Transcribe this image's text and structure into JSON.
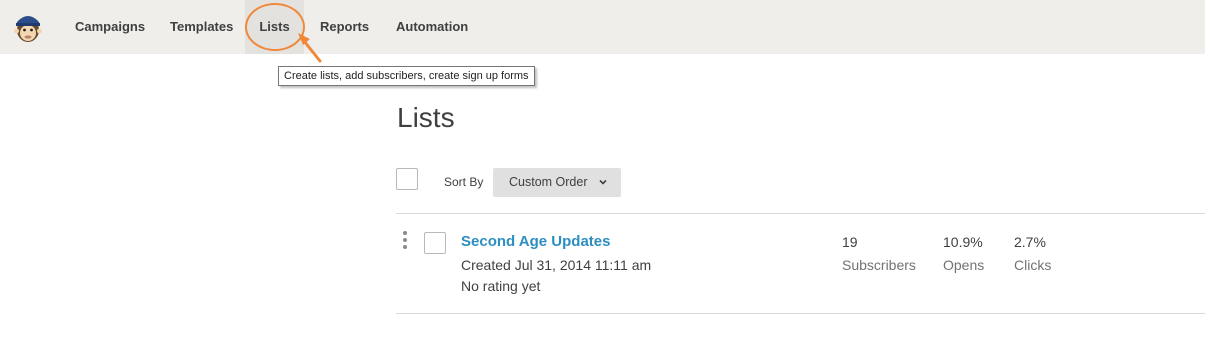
{
  "nav": {
    "logo_icon": "mailchimp-monkey-icon",
    "items": [
      {
        "label": "Campaigns"
      },
      {
        "label": "Templates"
      },
      {
        "label": "Lists"
      },
      {
        "label": "Reports"
      },
      {
        "label": "Automation"
      }
    ],
    "active_item": "Lists"
  },
  "tooltip": {
    "text": "Create lists, add subscribers, create sign up forms"
  },
  "page": {
    "title": "Lists"
  },
  "toolbar": {
    "sort_label": "Sort By",
    "sort_value": "Custom Order"
  },
  "lists": [
    {
      "name": "Second Age Updates",
      "created": "Created Jul 31, 2014 11:11 am",
      "rating": "No rating yet",
      "stats": [
        {
          "value": "19",
          "label": "Subscribers"
        },
        {
          "value": "10.9%",
          "label": "Opens"
        },
        {
          "value": "2.7%",
          "label": "Clicks"
        }
      ]
    }
  ],
  "colors": {
    "accent_link": "#2d8ec1",
    "highlight_annotation": "#f0883a",
    "topbar_bg": "#efeeea"
  }
}
